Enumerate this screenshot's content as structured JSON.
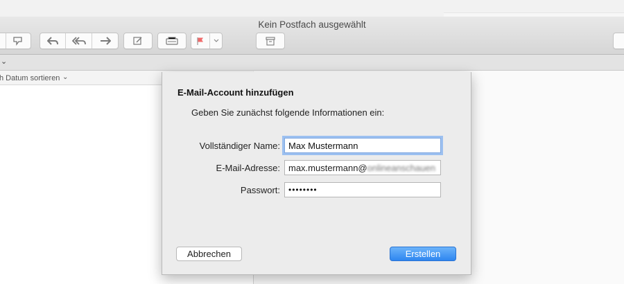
{
  "window": {
    "title": "Kein Postfach ausgewählt"
  },
  "toolbar": {
    "icons": [
      "junk-icon",
      "reply-icon",
      "reply-all-icon",
      "forward-icon",
      "compose-icon",
      "notes-icon",
      "flag-icon",
      "chevron-down-icon",
      "archive-icon"
    ],
    "flag_color": "#f06a6a"
  },
  "filter": {
    "chevron": "⌄"
  },
  "sort": {
    "label": "h Datum sortieren",
    "chevron": "⌄"
  },
  "dialog": {
    "title": "E-Mail-Account hinzufügen",
    "subtitle": "Geben Sie zunächst folgende Informationen ein:",
    "fields": {
      "name": {
        "label": "Vollständiger Name:",
        "value": "Max Mustermann"
      },
      "email": {
        "label": "E-Mail-Adresse:",
        "value": "max.mustermann@",
        "value_blurred": "onlineanschauen"
      },
      "password": {
        "label": "Passwort:",
        "value": "••••••••"
      }
    },
    "cancel_label": "Abbrechen",
    "create_label": "Erstellen",
    "accent_color": "#2e86f0"
  }
}
